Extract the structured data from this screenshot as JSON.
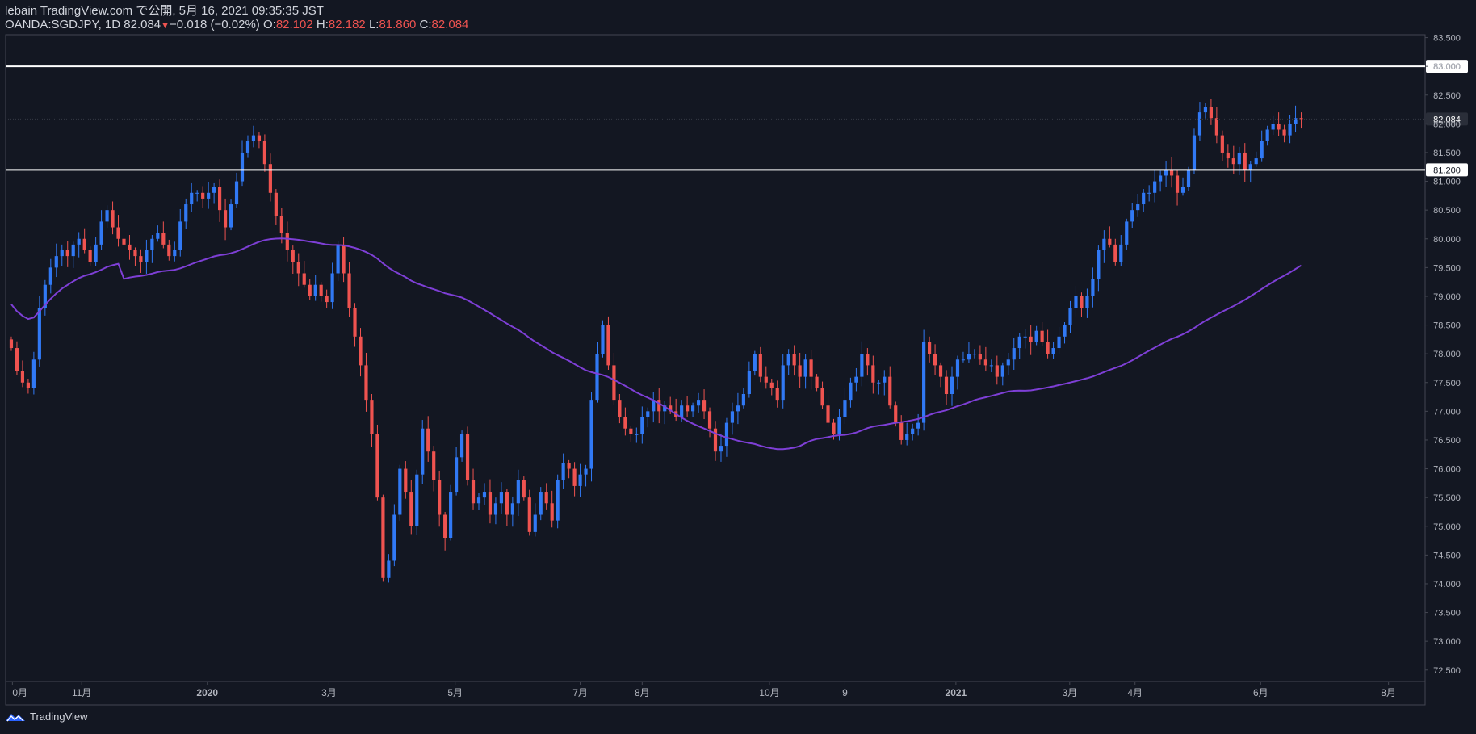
{
  "header": {
    "publisher_line": "lebain TradingView.com で公開, 5月 16, 2021 09:35:35 JST",
    "symbol": "OANDA:SGDJPY, 1D 82.084",
    "change": "−0.018 (−0.02%)",
    "o_label": "O:",
    "o_value": "82.102",
    "h_label": "H:",
    "h_value": "82.182",
    "l_label": "L:",
    "l_value": "81.860",
    "c_label": "C:",
    "c_value": "82.084"
  },
  "footer": {
    "brand": "TradingView"
  },
  "colors": {
    "background": "#131722",
    "up": "#2962ff",
    "up_body": "#3179f5",
    "down": "#ef5350",
    "ma": "#7e3fd6",
    "hline": "#ffffff",
    "axis_text": "#b2b5be",
    "grid": "#2a2e39"
  },
  "chart_data": {
    "type": "candlestick",
    "symbol": "OANDA:SGDJPY",
    "interval": "1D",
    "ylim": [
      72.3,
      83.55
    ],
    "y_ticks": [
      "83.500",
      "83.000",
      "82.500",
      "82.000",
      "81.500",
      "81.000",
      "80.500",
      "80.000",
      "79.500",
      "79.000",
      "78.500",
      "78.000",
      "77.500",
      "77.000",
      "76.500",
      "76.000",
      "75.500",
      "75.000",
      "74.500",
      "74.000",
      "73.500",
      "73.000",
      "72.500"
    ],
    "x_ticks": [
      {
        "label": "0月",
        "x": 0.2
      },
      {
        "label": "11月",
        "x": 12.5
      },
      {
        "label": "2020",
        "x": 34.8
      },
      {
        "label": "3月",
        "x": 56.4
      },
      {
        "label": "5月",
        "x": 78.8
      },
      {
        "label": "7月",
        "x": 101.0
      },
      {
        "label": "8月",
        "x": 112.0
      },
      {
        "label": "10月",
        "x": 134.6
      },
      {
        "label": "9",
        "x": 148.0
      },
      {
        "label": "2021",
        "x": 167.7
      },
      {
        "label": "3月",
        "x": 187.9
      },
      {
        "label": "4月",
        "x": 199.5
      },
      {
        "label": "6月",
        "x": 221.8
      },
      {
        "label": "8月",
        "x": 244.5
      }
    ],
    "x_range": [
      -1,
      251
    ],
    "horizontal_lines": [
      {
        "value": 83.0,
        "label": "83.000"
      },
      {
        "value": 81.2,
        "label": "81.200"
      }
    ],
    "last_price": {
      "value": 82.084,
      "label": "82.084"
    },
    "close": [
      78.1,
      77.7,
      77.5,
      77.4,
      77.9,
      78.8,
      79.2,
      79.5,
      79.7,
      79.8,
      79.7,
      79.9,
      80.0,
      79.8,
      79.6,
      79.9,
      80.3,
      80.5,
      80.2,
      80.0,
      79.9,
      79.8,
      79.7,
      79.6,
      79.8,
      80.0,
      80.1,
      79.9,
      79.7,
      79.8,
      80.3,
      80.6,
      80.8,
      80.8,
      80.7,
      80.8,
      80.9,
      80.5,
      80.2,
      80.6,
      81.0,
      81.5,
      81.7,
      81.8,
      81.7,
      81.3,
      80.8,
      80.4,
      80.1,
      79.8,
      79.6,
      79.4,
      79.2,
      79.0,
      79.2,
      79.0,
      78.9,
      79.4,
      79.9,
      79.4,
      78.8,
      78.3,
      77.8,
      77.2,
      76.6,
      75.5,
      74.1,
      74.4,
      75.2,
      76.0,
      75.6,
      75.0,
      75.9,
      76.7,
      76.3,
      75.8,
      75.2,
      74.8,
      75.6,
      76.2,
      76.6,
      75.8,
      75.4,
      75.5,
      75.6,
      75.2,
      75.4,
      75.6,
      75.2,
      75.4,
      75.8,
      75.5,
      74.9,
      75.2,
      75.6,
      75.4,
      75.1,
      75.8,
      76.1,
      76.0,
      75.7,
      75.9,
      76.0,
      77.2,
      78.0,
      78.5,
      77.8,
      77.2,
      76.9,
      76.7,
      76.6,
      76.6,
      76.9,
      77.0,
      77.2,
      77.0,
      77.1,
      77.0,
      76.9,
      77.1,
      77.0,
      77.1,
      77.2,
      77.0,
      76.7,
      76.3,
      76.4,
      76.8,
      77.0,
      77.1,
      77.3,
      77.7,
      78.0,
      77.6,
      77.5,
      77.4,
      77.2,
      77.8,
      78.0,
      77.8,
      77.6,
      77.9,
      77.6,
      77.4,
      77.1,
      76.8,
      76.6,
      76.9,
      77.2,
      77.5,
      77.6,
      78.0,
      77.8,
      77.5,
      77.5,
      77.6,
      77.1,
      76.8,
      76.5,
      76.6,
      76.7,
      76.8,
      78.2,
      78.0,
      77.8,
      77.6,
      77.3,
      77.6,
      77.9,
      77.9,
      78.0,
      78.0,
      77.9,
      77.8,
      77.8,
      77.6,
      77.8,
      77.9,
      78.1,
      78.3,
      78.3,
      78.2,
      78.4,
      78.2,
      78.0,
      78.1,
      78.3,
      78.5,
      78.8,
      79.0,
      78.8,
      79.0,
      79.3,
      79.8,
      80.0,
      79.9,
      79.6,
      79.9,
      80.3,
      80.5,
      80.6,
      80.8,
      80.8,
      81.0,
      81.1,
      81.2,
      81.1,
      80.8,
      80.9,
      81.2,
      81.8,
      82.2,
      82.3,
      82.1,
      81.8,
      81.5,
      81.4,
      81.3,
      81.5,
      81.2,
      81.3,
      81.4,
      81.7,
      81.9,
      82.0,
      81.9,
      81.8,
      82.0,
      82.1,
      82.084
    ]
  }
}
